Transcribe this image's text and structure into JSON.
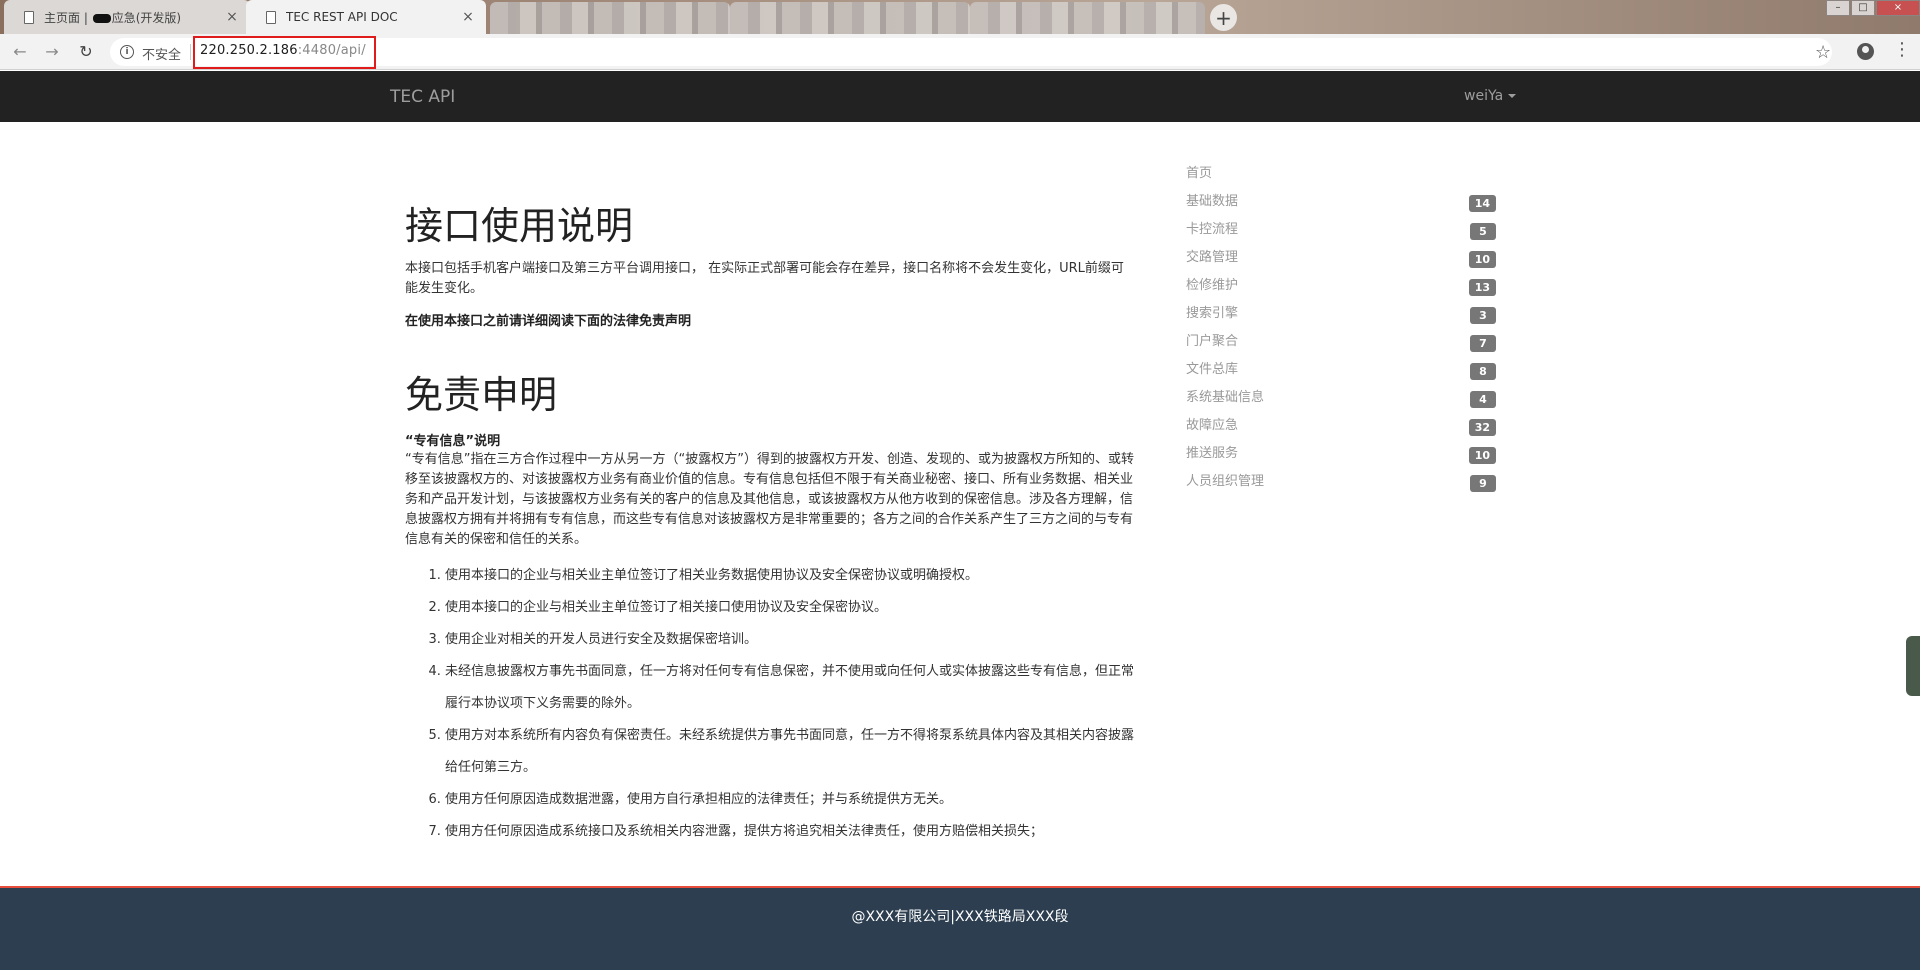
{
  "browser": {
    "tabs": [
      {
        "title_prefix": "主页面 | ",
        "title_suffix": "应急(开发版)"
      },
      {
        "title": "TEC REST API DOC"
      }
    ],
    "close_glyph": "×",
    "new_tab_glyph": "+",
    "back_glyph": "←",
    "forward_glyph": "→",
    "reload_glyph": "↻",
    "info_glyph": "i",
    "security_label": "不安全",
    "url_host": "220.250.2.186",
    "url_rest": ":4480/api/",
    "bookmark_glyph": "☆",
    "menu_glyph": "⋮",
    "window_controls": {
      "minimize": "–",
      "maximize": "□",
      "close": "×"
    }
  },
  "navbar": {
    "brand": "TEC API",
    "user": "weiYa"
  },
  "content": {
    "usage_heading": "接口使用说明",
    "usage_intro": "本接口包括手机客户端接口及第三方平台调用接口， 在实际正式部署可能会存在差异，接口名称将不会发生变化，URL前缀可能发生变化。",
    "usage_note": "在使用本接口之前请详细阅读下面的法律免责声明",
    "disclaimer_heading": "免责申明",
    "definition_title": "“专有信息”说明",
    "definition_body": "“专有信息”指在三方合作过程中一方从另一方（“披露权方”）得到的披露权方开发、创造、发现的、或为披露权方所知的、或转移至该披露权方的、对该披露权方业务有商业价值的信息。专有信息包括但不限于有关商业秘密、接口、所有业务数据、相关业务和产品开发计划，与该披露权方业务有关的客户的信息及其他信息，或该披露权方从他方收到的保密信息。涉及各方理解，信息披露权方拥有并将拥有专有信息，而这些专有信息对该披露权方是非常重要的；各方之间的合作关系产生了三方之间的与专有信息有关的保密和信任的关系。",
    "rules": [
      "使用本接口的企业与相关业主单位签订了相关业务数据使用协议及安全保密协议或明确授权。",
      "使用本接口的企业与相关业主单位签订了相关接口使用协议及安全保密协议。",
      "使用企业对相关的开发人员进行安全及数据保密培训。",
      "未经信息披露权方事先书面同意，任一方将对任何专有信息保密，并不使用或向任何人或实体披露这些专有信息，但正常履行本协议项下义务需要的除外。",
      "使用方对本系统所有内容负有保密责任。未经系统提供方事先书面同意，任一方不得将泵系统具体内容及其相关内容披露给任何第三方。",
      "使用方任何原因造成数据泄露，使用方自行承担相应的法律责任；并与系统提供方无关。",
      "使用方任何原因造成系统接口及系统相关内容泄露，提供方将追究相关法律责任，使用方赔偿相关损失；"
    ]
  },
  "sidebar": {
    "items": [
      {
        "label": "首页",
        "count": ""
      },
      {
        "label": "基础数据",
        "count": "14"
      },
      {
        "label": "卡控流程",
        "count": "5"
      },
      {
        "label": "交路管理",
        "count": "10"
      },
      {
        "label": "检修维护",
        "count": "13"
      },
      {
        "label": "搜索引擎",
        "count": "3"
      },
      {
        "label": "门户聚合",
        "count": "7"
      },
      {
        "label": "文件总库",
        "count": "8"
      },
      {
        "label": "系统基础信息",
        "count": "4"
      },
      {
        "label": "故障应急",
        "count": "32"
      },
      {
        "label": "推送服务",
        "count": "10"
      },
      {
        "label": "人员组织管理",
        "count": "9"
      }
    ]
  },
  "footer": {
    "text": "@XXX有限公司|XXX铁路局XXX段"
  },
  "colors": {
    "navbar_bg": "#222222",
    "footer_bg": "#2c3e50",
    "footer_accent": "#e74c3c",
    "badge_bg": "#777777",
    "url_highlight": "#e01b1b"
  },
  "icons": [
    "document-icon",
    "close-icon",
    "new-tab-icon",
    "back-icon",
    "forward-icon",
    "reload-icon",
    "info-icon",
    "star-icon",
    "profile-icon",
    "menu-icon",
    "caret-down-icon"
  ]
}
